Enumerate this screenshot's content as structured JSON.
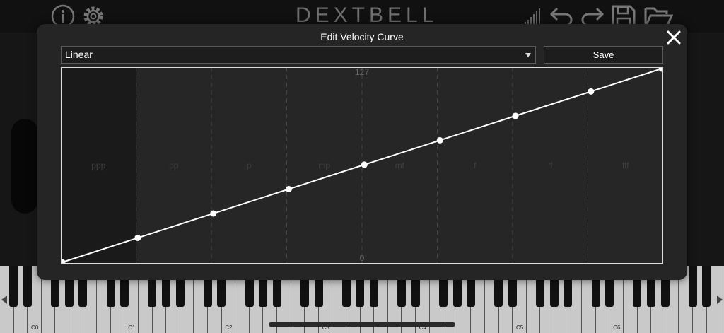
{
  "app": {
    "logo_text": "DEXTBELL"
  },
  "toolbar": {
    "icons": [
      "info-icon",
      "settings-gear-icon",
      "signal-bars-icon",
      "undo-icon",
      "redo-icon",
      "save-disk-icon",
      "folder-open-icon"
    ]
  },
  "modal": {
    "title": "Edit Velocity Curve",
    "preset": "Linear",
    "save_label": "Save",
    "close_icon": "close-icon"
  },
  "graph": {
    "y_max_label": "127",
    "y_min_label": "0",
    "zones": [
      "ppp",
      "pp",
      "p",
      "mp",
      "mf",
      "f",
      "ff",
      "fff"
    ],
    "highlight_color": "#1a1a1a",
    "line_color": "#ffffff"
  },
  "chart_data": {
    "type": "line",
    "title": "",
    "x": [
      0,
      16,
      32,
      48,
      64,
      80,
      96,
      112,
      127
    ],
    "y": [
      0,
      16,
      32,
      48,
      64,
      80,
      96,
      112,
      127
    ],
    "ylim": [
      0,
      127
    ],
    "xlim": [
      0,
      127
    ],
    "grid": true
  },
  "keyboard": {
    "labels": [
      "C0",
      "C1",
      "C2",
      "C3",
      "C4",
      "C5",
      "C6"
    ]
  }
}
